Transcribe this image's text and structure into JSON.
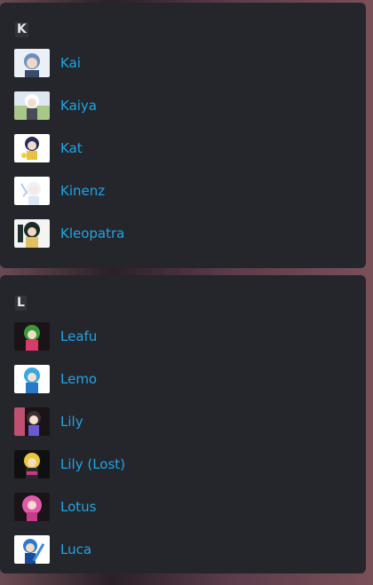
{
  "sections": [
    {
      "letter": "K",
      "items": [
        {
          "name": "Kai",
          "icon": "kai-avatar-icon"
        },
        {
          "name": "Kaiya",
          "icon": "kaiya-avatar-icon"
        },
        {
          "name": "Kat",
          "icon": "kat-avatar-icon"
        },
        {
          "name": "Kinenz",
          "icon": "kinenz-avatar-icon"
        },
        {
          "name": "Kleopatra",
          "icon": "kleopatra-avatar-icon"
        }
      ]
    },
    {
      "letter": "L",
      "items": [
        {
          "name": "Leafu",
          "icon": "leafu-avatar-icon"
        },
        {
          "name": "Lemo",
          "icon": "lemo-avatar-icon"
        },
        {
          "name": "Lily",
          "icon": "lily-avatar-icon"
        },
        {
          "name": "Lily (Lost)",
          "icon": "lily-lost-avatar-icon"
        },
        {
          "name": "Lotus",
          "icon": "lotus-avatar-icon"
        },
        {
          "name": "Luca",
          "icon": "luca-avatar-icon"
        }
      ]
    }
  ],
  "colors": {
    "panel": "#25262b",
    "link": "#1ea5e6",
    "letter": "#e6e6e6"
  }
}
